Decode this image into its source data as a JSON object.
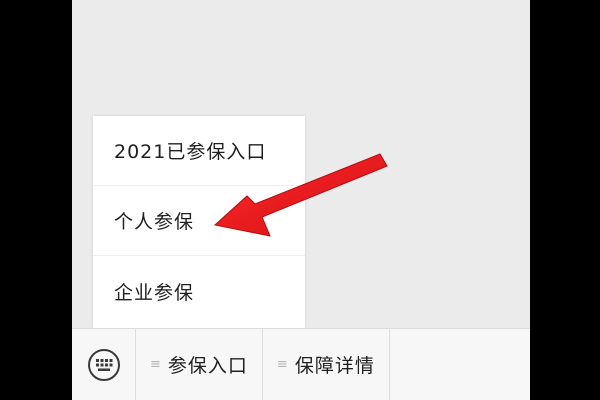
{
  "popup_menu": {
    "items": [
      {
        "label": "2021已参保入口"
      },
      {
        "label": "个人参保"
      },
      {
        "label": "企业参保"
      }
    ]
  },
  "bottom_bar": {
    "keyboard_icon": "keyboard-icon",
    "menu_icon": "menu-lines-icon",
    "buttons": [
      {
        "label": "参保入口"
      },
      {
        "label": "保障详情"
      }
    ]
  },
  "annotation": {
    "arrow_color": "#e8141b",
    "arrow_target": "个人参保"
  },
  "colors": {
    "background": "#ebebeb",
    "letterbox": "#000000",
    "bar": "#f7f7f7"
  }
}
